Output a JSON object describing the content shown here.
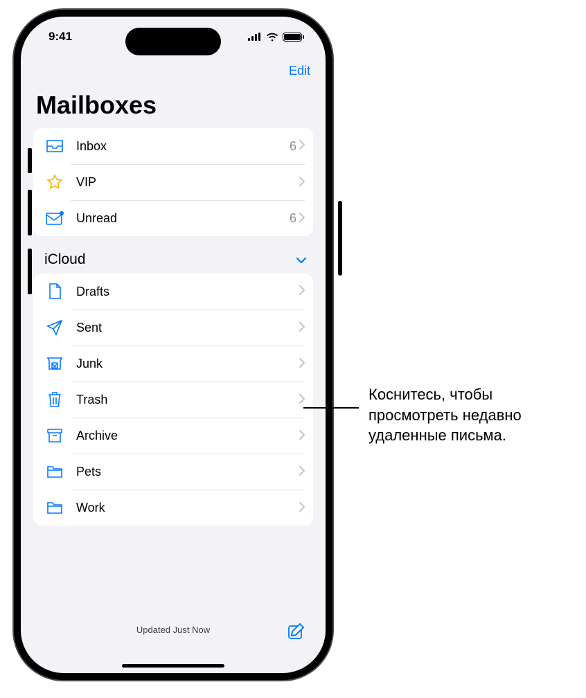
{
  "status": {
    "time": "9:41"
  },
  "nav": {
    "edit": "Edit"
  },
  "page_title": "Mailboxes",
  "smart_mailboxes": [
    {
      "key": "inbox",
      "label": "Inbox",
      "count": "6"
    },
    {
      "key": "vip",
      "label": "VIP",
      "count": ""
    },
    {
      "key": "unread",
      "label": "Unread",
      "count": "6"
    }
  ],
  "account_section": {
    "name": "iCloud"
  },
  "icloud_boxes": [
    {
      "key": "drafts",
      "label": "Drafts"
    },
    {
      "key": "sent",
      "label": "Sent"
    },
    {
      "key": "junk",
      "label": "Junk"
    },
    {
      "key": "trash",
      "label": "Trash"
    },
    {
      "key": "archive",
      "label": "Archive"
    },
    {
      "key": "pets",
      "label": "Pets"
    },
    {
      "key": "work",
      "label": "Work"
    }
  ],
  "toolbar": {
    "status": "Updated Just Now"
  },
  "callout": {
    "text": "Коснитесь, чтобы просмотреть недавно удаленные письма."
  }
}
